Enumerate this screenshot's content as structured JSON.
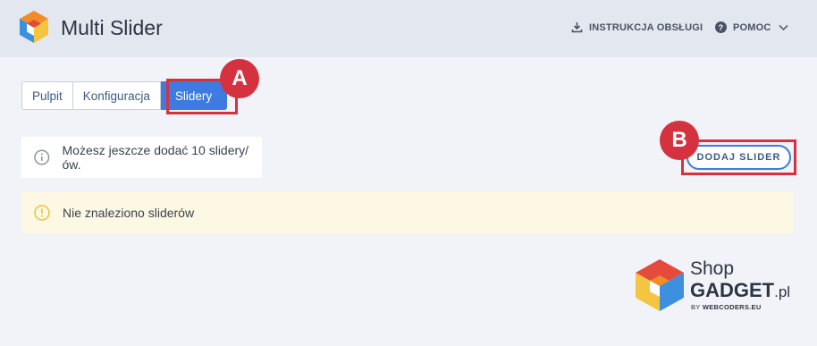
{
  "app": {
    "title": "Multi Slider"
  },
  "header": {
    "manual_label": "INSTRUKCJA OBSŁUGI",
    "manual_icon": "download-icon",
    "help_label": "POMOC",
    "help_icon": "question-circle-icon",
    "help_chevron": "chevron-down-icon"
  },
  "tabs": [
    {
      "label": "Pulpit",
      "active": false
    },
    {
      "label": "Konfiguracja",
      "active": false
    },
    {
      "label": "Slidery",
      "active": true
    }
  ],
  "annotations": {
    "a": "A",
    "b": "B"
  },
  "info": {
    "icon": "info-circle-icon",
    "text": "Możesz jeszcze dodać 10 slidery/ów."
  },
  "add_button": {
    "label": "DODAJ SLIDER"
  },
  "warning": {
    "icon": "warning-circle-icon",
    "text": "Nie znaleziono sliderów"
  },
  "brand": {
    "shop": "Shop",
    "gadget": "GADGET",
    "tld": ".pl",
    "by_prefix": "BY",
    "by_company": "WEBCODERS.EU"
  },
  "colors": {
    "accent": "#3d7be0",
    "marker": "#d5323f",
    "warning_bg": "#fdf8e3",
    "header_bg": "#e3e7f0"
  }
}
